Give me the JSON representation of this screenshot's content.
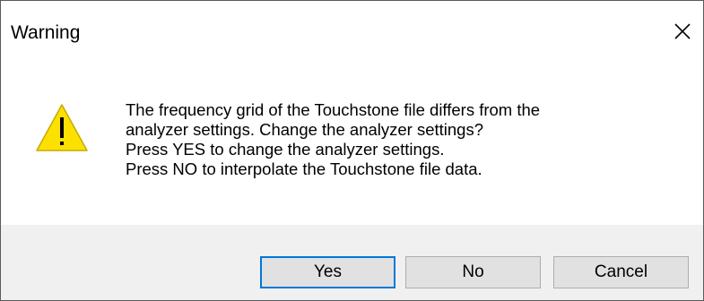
{
  "window": {
    "title": "Warning"
  },
  "icons": {
    "warning": "warning-icon",
    "close": "close-icon"
  },
  "message": {
    "lines": [
      "The frequency grid of the Touchstone file differs from the",
      "analyzer settings. Change the analyzer settings?",
      "Press YES to change the analyzer settings.",
      "Press NO to interpolate the Touchstone file data."
    ]
  },
  "buttons": {
    "yes": "Yes",
    "no": "No",
    "cancel": "Cancel"
  },
  "colors": {
    "warning_fill": "#FCE100",
    "default_button_border": "#0078D7",
    "footer_background": "#F0F0F0"
  }
}
